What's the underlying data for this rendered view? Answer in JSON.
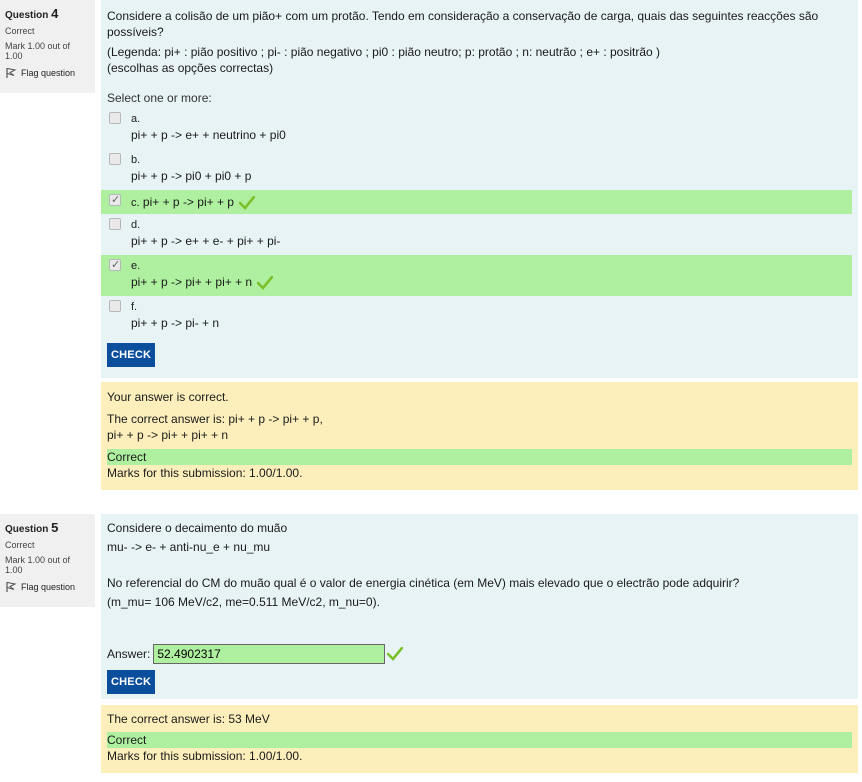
{
  "q4": {
    "info": {
      "label": "Question",
      "number": "4",
      "state": "Correct",
      "grade": "Mark 1.00 out of 1.00",
      "flag": "Flag question"
    },
    "text": [
      "Considere a colisão de um pião+ com um protão. Tendo em consideração a conservação de carga, quais das seguintes reacções são possíveis?",
      "(Legenda:   pi+ : pião positivo ; pi- : pião negativo ; pi0 : pião neutro; p: protão ; n: neutrão ; e+ : positrão )",
      "(escolhas as opções correctas)"
    ],
    "prompt": "Select one or more:",
    "options": [
      {
        "letter": "a.",
        "text": "pi+ + p -> e+ + neutrino + pi0"
      },
      {
        "letter": "b.",
        "text": "pi+ + p -> pi0 + pi0 + p"
      },
      {
        "letter": "c.",
        "text": "pi+ + p -> pi+ + p"
      },
      {
        "letter": "d.",
        "text": "pi+ + p -> e+ + e- + pi+ + pi-"
      },
      {
        "letter": "e.",
        "text": "pi+ + p -> pi+ + pi+ + n"
      },
      {
        "letter": "f.",
        "text": "pi+ + p -> pi- + n"
      }
    ],
    "check_label": "CHECK",
    "feedback": {
      "your_answer": "Your answer is correct.",
      "correct_answer_1": "The correct answer is: pi+ + p -> pi+ + p,",
      "correct_answer_2": "pi+ + p -> pi+ + pi+ + n",
      "correct": "Correct",
      "marks": "Marks for this submission: 1.00/1.00."
    }
  },
  "q5": {
    "info": {
      "label": "Question",
      "number": "5",
      "state": "Correct",
      "grade": "Mark 1.00 out of 1.00",
      "flag": "Flag question"
    },
    "text_1": "Considere o decaimento do muão",
    "text_2": "mu- -> e- + anti-nu_e + nu_mu",
    "text_3": "No referencial do CM do muão qual é o valor de energia cinética (em MeV) mais elevado que o electrão pode adquirir?",
    "text_4": "(m_mu= 106 MeV/c2, me=0.511 MeV/c2, m_nu=0).",
    "answer_label": "Answer:",
    "answer_value": "52.4902317",
    "check_label": "CHECK",
    "feedback": {
      "correct_answer": "The correct answer is: 53 MeV",
      "correct": "Correct",
      "marks": "Marks for this submission: 1.00/1.00."
    }
  },
  "colors": {
    "formulation": "#e7f3f5",
    "outcome": "#fcefbc",
    "correct": "#aff0a0",
    "button": "#0b4f9c",
    "tick": "#7bbf2a"
  },
  "icons": {
    "flag": "flag-icon",
    "tick": "check-icon"
  }
}
